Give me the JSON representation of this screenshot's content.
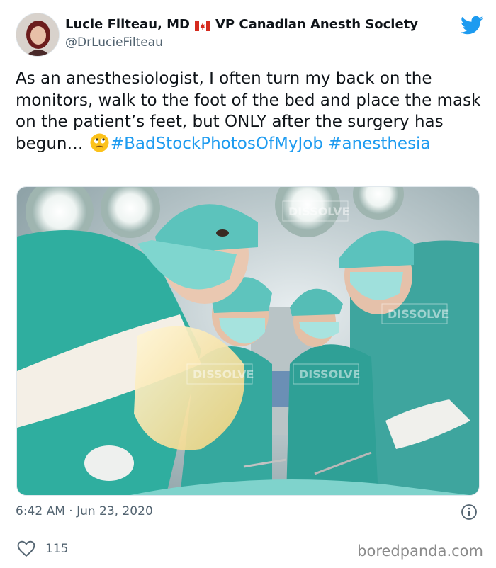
{
  "tweet": {
    "display_name": "Lucie Filteau, MD",
    "flag_icon": "canada-flag-icon",
    "title_suffix": "VP Canadian Anesth Society",
    "handle": "@DrLucieFilteau",
    "text_parts": [
      "As an anesthesiologist, I often turn my back on the monitors, walk to the foot of the bed and place the mask on the patient’s feet, but ONLY after the surgery has begun… "
    ],
    "emoji": "rolling-eyes-face-icon",
    "hashtags": [
      "#BadStockPhotosOfMyJob",
      "#anesthesia"
    ],
    "photo_watermark": "DISSOLVE",
    "timestamp": "6:42 AM · Jun 23, 2020",
    "likes": "115"
  },
  "brand": {
    "twitter_icon": "twitter-bird-icon",
    "twitter_color": "#1d9bf0",
    "link_color": "#1d9bf0"
  },
  "footer": {
    "watermark": "boredpanda.com"
  }
}
